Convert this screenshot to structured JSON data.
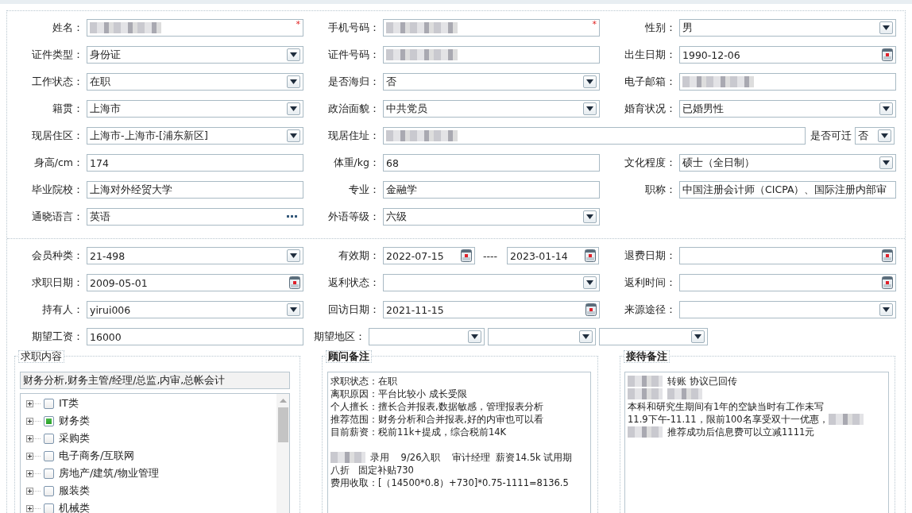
{
  "basic_info": [
    [
      {
        "label": "姓名：",
        "kind": "text",
        "redacted": true,
        "required_mark": "*"
      },
      {
        "label": "手机号码：",
        "kind": "text",
        "redacted": true,
        "required_mark": "*"
      },
      {
        "label": "性别：",
        "kind": "select",
        "value": "男"
      }
    ],
    [
      {
        "label": "证件类型：",
        "kind": "select",
        "value": "身份证"
      },
      {
        "label": "证件号码：",
        "kind": "text",
        "redacted": true
      },
      {
        "label": "出生日期：",
        "kind": "date",
        "value": "1990-12-06"
      }
    ],
    [
      {
        "label": "工作状态：",
        "kind": "select",
        "value": "在职"
      },
      {
        "label": "是否海归：",
        "kind": "select",
        "value": "否"
      },
      {
        "label": "电子邮箱：",
        "kind": "text",
        "redacted": true
      }
    ],
    [
      {
        "label": "籍贯：",
        "kind": "select",
        "value": "上海市"
      },
      {
        "label": "政治面貌：",
        "kind": "select",
        "value": "中共党员"
      },
      {
        "label": "婚育状况：",
        "kind": "select",
        "value": "已婚男性"
      }
    ],
    [
      {
        "label": "现居住区：",
        "kind": "select",
        "value": " 上海市-上海市-[浦东新区]"
      },
      {
        "label": "现居住址：",
        "kind": "text",
        "redacted": true
      },
      {
        "label": "是否可迁",
        "kind": "compact-select",
        "value": "否"
      }
    ],
    [
      {
        "label": "身高/cm：",
        "kind": "text",
        "value": "174"
      },
      {
        "label": "体重/kg：",
        "kind": "text",
        "value": "68"
      },
      {
        "label": "文化程度：",
        "kind": "select",
        "value": "硕士（全日制）"
      }
    ],
    [
      {
        "label": "毕业院校：",
        "kind": "text",
        "value": "上海对外经贸大学"
      },
      {
        "label": "专业：",
        "kind": "text",
        "value": "金融学"
      },
      {
        "label": "职称：",
        "kind": "text",
        "value": "中国注册会计师（CICPA）、国际注册内部审"
      }
    ],
    [
      {
        "label": "通晓语言：",
        "kind": "more",
        "value": "英语"
      },
      {
        "label": "外语等级：",
        "kind": "select",
        "value": "六级"
      }
    ]
  ],
  "member_info": [
    [
      {
        "label": "会员种类：",
        "kind": "select",
        "value": " 21-498"
      },
      {
        "label": "有效期：",
        "kind": "date-range",
        "values": [
          "2022-07-15",
          "2023-01-14"
        ],
        "separator": "----"
      },
      {
        "label": "退费日期：",
        "kind": "date"
      }
    ],
    [
      {
        "label": "求职日期：",
        "kind": "date",
        "value": "2009-05-01"
      },
      {
        "label": "返利状态：",
        "kind": "select"
      },
      {
        "label": "返利时间：",
        "kind": "date"
      }
    ],
    [
      {
        "label": "持有人：",
        "kind": "select",
        "value": "yirui006"
      },
      {
        "label": "回访日期：",
        "kind": "date",
        "value": "2021-11-15"
      },
      {
        "label": "来源途径：",
        "kind": "select"
      }
    ],
    [
      {
        "label": "期望工资：",
        "kind": "text",
        "value": "16000"
      },
      {
        "label": "期望地区：",
        "kind": "triple-select"
      }
    ]
  ],
  "job_content": {
    "legend": "求职内容",
    "summary": "财务分析,财务主管/经理/总监,内审,总帐会计",
    "tree": [
      {
        "label": "IT类",
        "checked": false,
        "expanded": false
      },
      {
        "label": "财务类",
        "checked": true,
        "expanded": false
      },
      {
        "label": "采购类",
        "checked": false,
        "expanded": false
      },
      {
        "label": "电子商务/互联网",
        "checked": false,
        "expanded": false
      },
      {
        "label": "房地产/建筑/物业管理",
        "checked": false,
        "expanded": false
      },
      {
        "label": "服装类",
        "checked": false,
        "expanded": false
      },
      {
        "label": "机械类",
        "checked": false,
        "expanded": false
      }
    ]
  },
  "notes": [
    {
      "legend": "顾问备注",
      "lines": [
        {
          "kind": "text",
          "parts": [
            {
              "kind": "text",
              "text": "求职状态：在职"
            }
          ]
        },
        {
          "kind": "text",
          "parts": [
            {
              "kind": "text",
              "text": "离职原因：平台比较小 成长受限"
            }
          ]
        },
        {
          "kind": "text",
          "parts": [
            {
              "kind": "text",
              "text": "个人擅长：擅长合并报表,数据敏感，管理报表分析"
            }
          ]
        },
        {
          "kind": "text",
          "parts": [
            {
              "kind": "text",
              "text": "推荐范围：财务分析和合并报表,好的内审也可以看"
            }
          ]
        },
        {
          "kind": "text",
          "parts": [
            {
              "kind": "text",
              "text": "目前薪资：税前11k+提成，综合税前14K"
            }
          ]
        },
        {
          "kind": "blank"
        },
        {
          "kind": "text",
          "parts": [
            {
              "kind": "redacted"
            },
            {
              "kind": "text",
              "text": "录用    9/26入职    审计经理  薪资14.5k 试用期"
            }
          ]
        },
        {
          "kind": "text",
          "parts": [
            {
              "kind": "text",
              "text": "八折   固定补贴730"
            }
          ]
        },
        {
          "kind": "text",
          "parts": [
            {
              "kind": "text",
              "text": "费用收取：[（14500*0.8）+730]*0.75-1111=8136.5"
            }
          ]
        }
      ]
    },
    {
      "legend": "接待备注",
      "lines": [
        {
          "kind": "text",
          "parts": [
            {
              "kind": "redacted"
            },
            {
              "kind": "text",
              "text": "转账 协议已回传"
            }
          ]
        },
        {
          "kind": "text",
          "parts": [
            {
              "kind": "redacted"
            },
            {
              "kind": "redacted"
            }
          ]
        },
        {
          "kind": "text",
          "parts": [
            {
              "kind": "text",
              "text": "本科和研究生期间有1年的空缺当时有工作未写"
            }
          ]
        },
        {
          "kind": "text",
          "parts": [
            {
              "kind": "text",
              "text": "11.9下午-11.11，限前100名享受双十一优惠，"
            },
            {
              "kind": "redacted"
            }
          ]
        },
        {
          "kind": "text",
          "parts": [
            {
              "kind": "redacted"
            },
            {
              "kind": "text",
              "text": "推荐成功后信息费可以立减1111元"
            }
          ]
        }
      ]
    }
  ]
}
